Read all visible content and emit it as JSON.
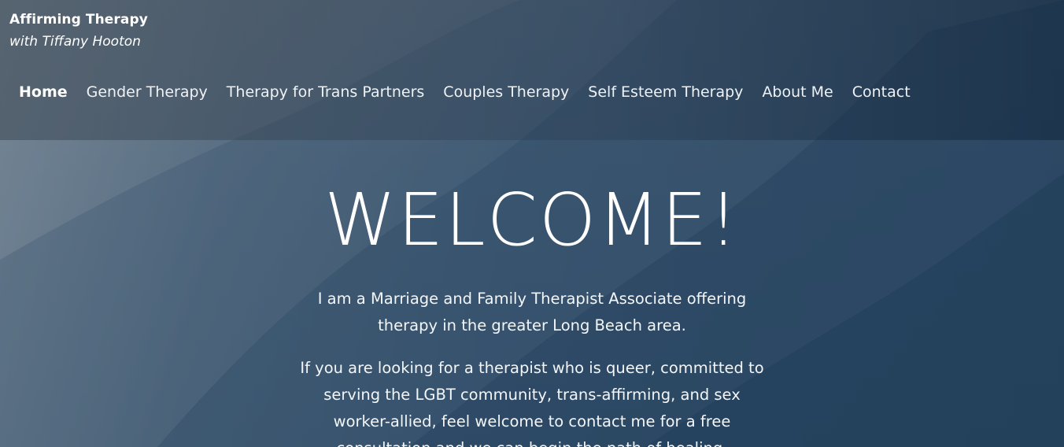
{
  "site": {
    "title": "Affirming Therapy",
    "tagline": "with Tiffany Hooton"
  },
  "nav": {
    "items": [
      {
        "label": "Home",
        "active": true
      },
      {
        "label": "Gender Therapy",
        "active": false
      },
      {
        "label": "Therapy for Trans Partners",
        "active": false
      },
      {
        "label": "Couples Therapy",
        "active": false
      },
      {
        "label": "Self Esteem Therapy",
        "active": false
      },
      {
        "label": "About Me",
        "active": false
      },
      {
        "label": "Contact",
        "active": false
      }
    ]
  },
  "main": {
    "heading": "WELCOME!",
    "paragraph_1": "I am a Marriage and Family Therapist Associate offering therapy in the greater Long Beach area.",
    "paragraph_2": "If you are looking for a therapist who is queer, committed to serving the LGBT community, trans-affirming, and sex worker-allied, feel welcome to contact me for a free consultation and we can begin the path of healing."
  },
  "colors": {
    "text": "#ffffff",
    "background_blue": "#3f5b75",
    "background_mist": "#96a0a8"
  }
}
